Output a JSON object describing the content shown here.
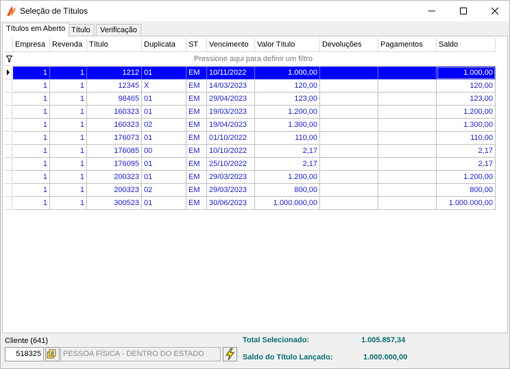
{
  "window": {
    "title": "Seleção de Títulos"
  },
  "tabs": [
    {
      "label": "Títulos em Aberto",
      "active": true
    },
    {
      "label": "Título",
      "active": false
    },
    {
      "label": "Verificação",
      "active": false
    }
  ],
  "grid": {
    "columns": [
      "Empresa",
      "Revenda",
      "Título",
      "Duplicata",
      "ST",
      "Vencimento",
      "Valor Título",
      "Devoluções",
      "Pagamentos",
      "Saldo"
    ],
    "filter_hint": "Pressione aqui para definir um filtro",
    "rows": [
      {
        "empresa": "1",
        "revenda": "1",
        "titulo": "1212",
        "duplicata": "01",
        "st": "EM",
        "vencimento": "10/11/2022",
        "valor": "1.000,00",
        "devolucoes": "",
        "pagamentos": "",
        "saldo": "1.000,00",
        "selected": true
      },
      {
        "empresa": "1",
        "revenda": "1",
        "titulo": "12345",
        "duplicata": "X",
        "st": "EM",
        "vencimento": "14/03/2023",
        "valor": "120,00",
        "devolucoes": "",
        "pagamentos": "",
        "saldo": "120,00"
      },
      {
        "empresa": "1",
        "revenda": "1",
        "titulo": "98465",
        "duplicata": "01",
        "st": "EM",
        "vencimento": "29/04/2023",
        "valor": "123,00",
        "devolucoes": "",
        "pagamentos": "",
        "saldo": "123,00"
      },
      {
        "empresa": "1",
        "revenda": "1",
        "titulo": "160323",
        "duplicata": "01",
        "st": "EM",
        "vencimento": "19/03/2023",
        "valor": "1.200,00",
        "devolucoes": "",
        "pagamentos": "",
        "saldo": "1.200,00"
      },
      {
        "empresa": "1",
        "revenda": "1",
        "titulo": "160323",
        "duplicata": "02",
        "st": "EM",
        "vencimento": "19/04/2023",
        "valor": "1.300,00",
        "devolucoes": "",
        "pagamentos": "",
        "saldo": "1.300,00"
      },
      {
        "empresa": "1",
        "revenda": "1",
        "titulo": "176073",
        "duplicata": "01",
        "st": "EM",
        "vencimento": "01/10/2022",
        "valor": "110,00",
        "devolucoes": "",
        "pagamentos": "",
        "saldo": "110,00"
      },
      {
        "empresa": "1",
        "revenda": "1",
        "titulo": "176085",
        "duplicata": "00",
        "st": "EM",
        "vencimento": "10/10/2022",
        "valor": "2,17",
        "devolucoes": "",
        "pagamentos": "",
        "saldo": "2,17"
      },
      {
        "empresa": "1",
        "revenda": "1",
        "titulo": "176095",
        "duplicata": "01",
        "st": "EM",
        "vencimento": "25/10/2022",
        "valor": "2,17",
        "devolucoes": "",
        "pagamentos": "",
        "saldo": "2,17"
      },
      {
        "empresa": "1",
        "revenda": "1",
        "titulo": "200323",
        "duplicata": "01",
        "st": "EM",
        "vencimento": "29/03/2023",
        "valor": "1.200,00",
        "devolucoes": "",
        "pagamentos": "",
        "saldo": "1.200,00"
      },
      {
        "empresa": "1",
        "revenda": "1",
        "titulo": "200323",
        "duplicata": "02",
        "st": "EM",
        "vencimento": "29/03/2023",
        "valor": "800,00",
        "devolucoes": "",
        "pagamentos": "",
        "saldo": "800,00"
      },
      {
        "empresa": "1",
        "revenda": "1",
        "titulo": "300523",
        "duplicata": "01",
        "st": "EM",
        "vencimento": "30/06/2023",
        "valor": "1.000.000,00",
        "devolucoes": "",
        "pagamentos": "",
        "saldo": "1.000.000,00"
      }
    ]
  },
  "footer": {
    "cliente_label": "Cliente (641)",
    "cliente_code": "518325",
    "cliente_desc": "PESSOA FÍSICA - DENTRO DO ESTADO",
    "total_selecionado_label": "Total Selecionado:",
    "total_selecionado_value": "1.005.857,34",
    "saldo_lancado_label": "Saldo do Título Lançado:",
    "saldo_lancado_value": "1.000.000,00"
  },
  "colors": {
    "selection": "#0000ff",
    "cell_text": "#1e1ec8",
    "totals": "#0b6e6e"
  },
  "icons": [
    "app-logo-icon",
    "minimize-icon",
    "maximize-icon",
    "close-icon",
    "filter-icon",
    "row-pointer-icon",
    "lookup-icon",
    "lightning-icon"
  ]
}
